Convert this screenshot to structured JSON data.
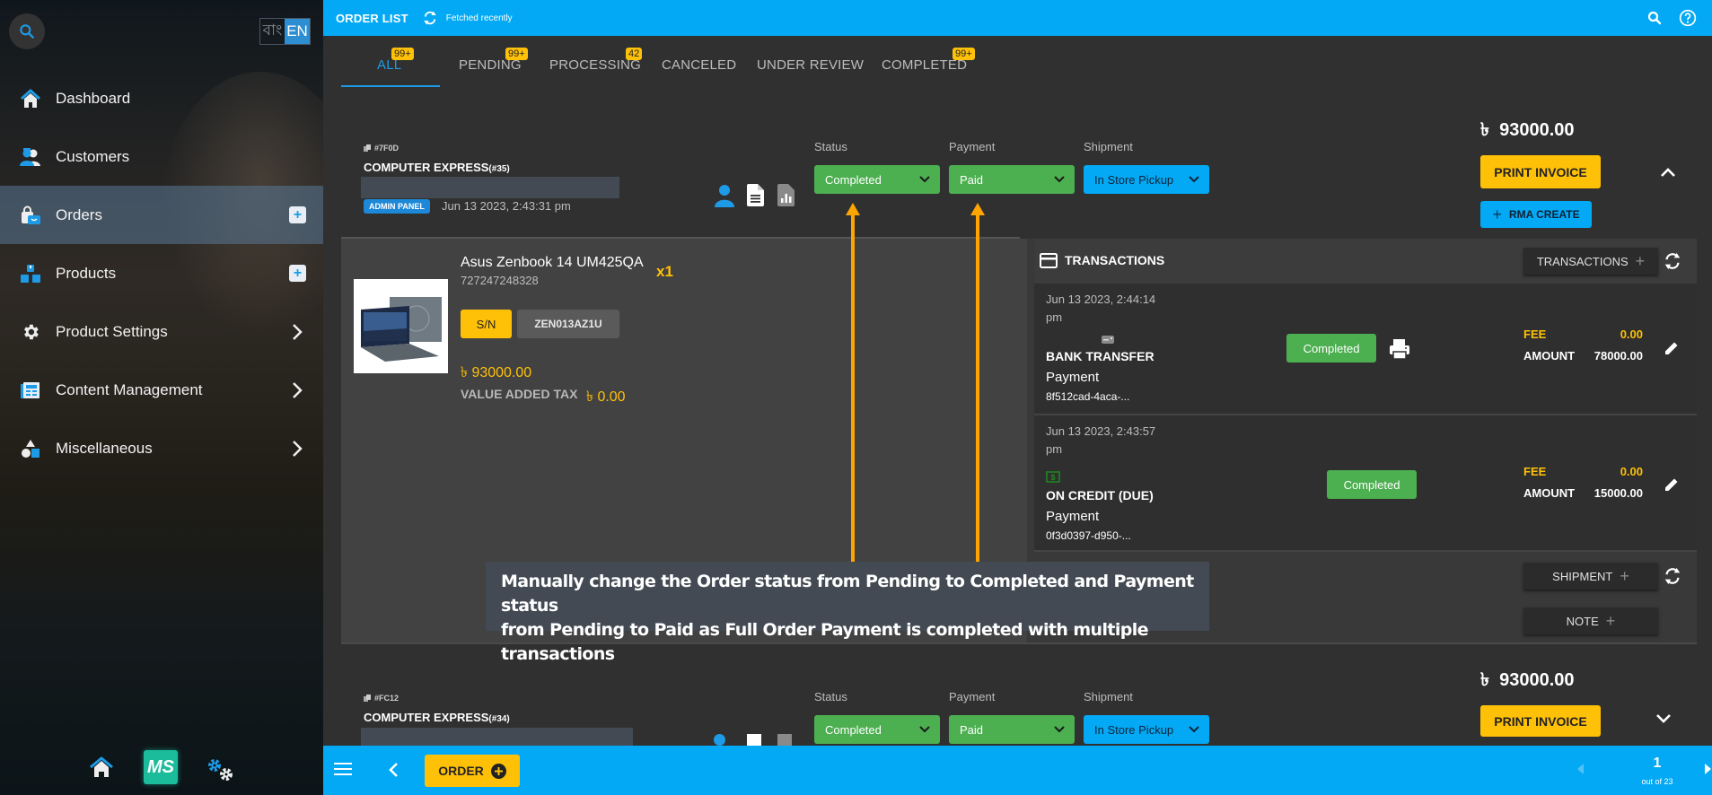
{
  "sidebar": {
    "language": {
      "bengali": "বাং",
      "english": "EN"
    },
    "items": [
      {
        "label": "Dashboard",
        "icon": "home-icon"
      },
      {
        "label": "Customers",
        "icon": "customers-icon"
      },
      {
        "label": "Orders",
        "icon": "orders-icon",
        "active": true,
        "has_add": true
      },
      {
        "label": "Products",
        "icon": "products-icon",
        "has_add": true
      },
      {
        "label": "Product Settings",
        "icon": "gear-icon",
        "has_submenu": true
      },
      {
        "label": "Content Management",
        "icon": "content-icon",
        "has_submenu": true
      },
      {
        "label": "Miscellaneous",
        "icon": "shapes-icon",
        "has_submenu": true
      }
    ],
    "bottom": {
      "logo_text": "MS"
    }
  },
  "header": {
    "title": "ORDER LIST",
    "fetch_status": "Fetched recently"
  },
  "tabs": [
    {
      "label": "ALL",
      "badge": "99+",
      "active": true
    },
    {
      "label": "PENDING",
      "badge": "99+"
    },
    {
      "label": "PROCESSING",
      "badge": "42"
    },
    {
      "label": "CANCELED",
      "badge": ""
    },
    {
      "label": "UNDER REVIEW",
      "badge": ""
    },
    {
      "label": "COMPLETED",
      "badge": "99+"
    }
  ],
  "labels": {
    "status": "Status",
    "payment": "Payment",
    "shipment": "Shipment",
    "print_invoice": "PRINT INVOICE",
    "rma_create": "RMA CREATE",
    "transactions": "TRANSACTIONS",
    "transactions_btn": "TRANSACTIONS",
    "shipment_btn": "SHIPMENT",
    "note_btn": "NOTE",
    "fee": "FEE",
    "amount": "AMOUNT",
    "sn": "S/N",
    "vat": "VALUE ADDED TAX",
    "currency": "৳"
  },
  "orders": [
    {
      "id": "#7F0D",
      "customer": "COMPUTER EXPRESS",
      "customer_no": "(#35)",
      "source": "ADMIN PANEL",
      "date": "Jun 13 2023, 2:43:31 pm",
      "status": "Completed",
      "payment": "Paid",
      "shipment": "In Store Pickup",
      "total": "93000.00",
      "expanded": true,
      "items": [
        {
          "name": "Asus Zenbook 14 UM425QA",
          "sku": "727247248328",
          "quantity": "x1",
          "serial": "ZEN013AZ1U",
          "price": "93000.00",
          "vat": "0.00"
        }
      ],
      "transactions": [
        {
          "date_line1": "Jun 13 2023, 2:44:14",
          "date_line2": "pm",
          "method": "BANK TRANSFER",
          "type": "Payment",
          "ref": "8f512cad-4aca-...",
          "status": "Completed",
          "fee": "0.00",
          "amount": "78000.00"
        },
        {
          "date_line1": "Jun 13 2023, 2:43:57",
          "date_line2": "pm",
          "method": "ON CREDIT (DUE)",
          "type": "Payment",
          "ref": "0f3d0397-d950-...",
          "status": "Completed",
          "fee": "0.00",
          "amount": "15000.00"
        }
      ]
    },
    {
      "id": "#FC12",
      "customer": "COMPUTER EXPRESS",
      "customer_no": "(#34)",
      "status": "Completed",
      "payment": "Paid",
      "shipment": "In Store Pickup",
      "total": "93000.00",
      "expanded": false
    }
  ],
  "annotation": {
    "line1": "Manually change the Order status from Pending to Completed and Payment status",
    "line2": "from Pending to Paid as Full Order Payment is completed with multiple transactions"
  },
  "footer": {
    "order_button": "ORDER",
    "page": "1",
    "page_total": "out of 23"
  },
  "colors": {
    "primary": "#03a9f4",
    "accent": "#ffc107",
    "success": "#4caf50"
  }
}
